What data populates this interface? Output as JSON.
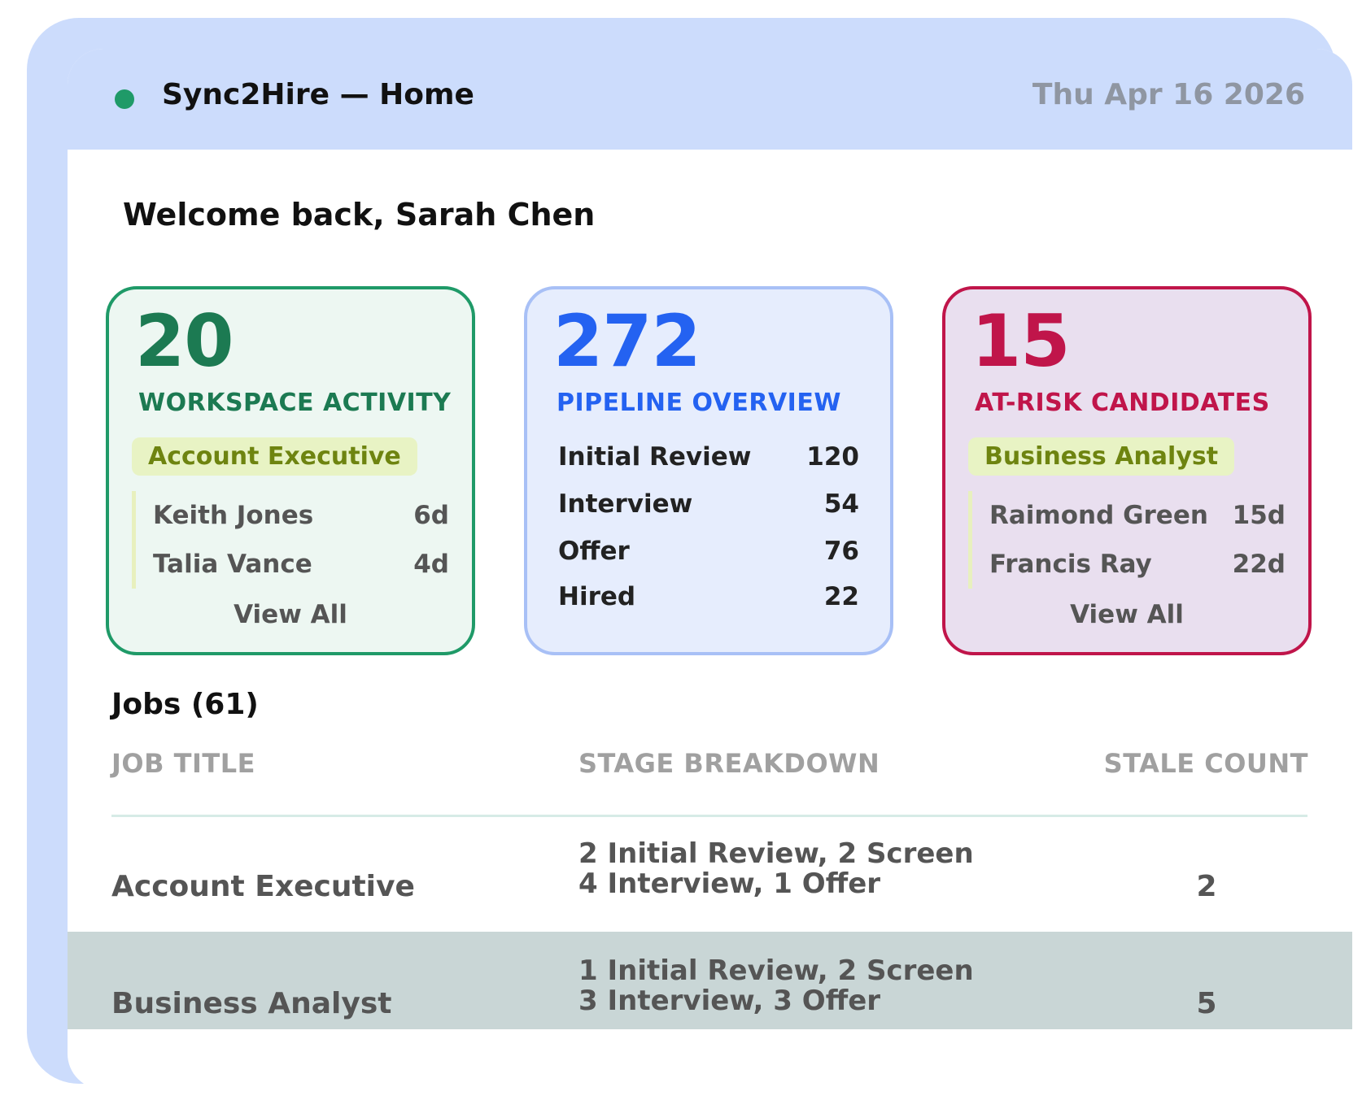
{
  "header": {
    "title": "Sync2Hire — Home",
    "date": "Thu Apr 16 2026",
    "status_color": "#1f9a68"
  },
  "welcome": "Welcome back, Sarah Chen",
  "cards": {
    "workspace": {
      "value": "20",
      "label": "WORKSPACE ACTIVITY",
      "tag": "Account Executive",
      "people": [
        {
          "name": "Keith Jones",
          "days": "6d"
        },
        {
          "name": "Talia Vance",
          "days": "4d"
        }
      ],
      "view_all": "View All",
      "color": "#1c7a52"
    },
    "pipeline": {
      "value": "272",
      "label": "PIPELINE OVERVIEW",
      "stages": [
        {
          "name": "Initial Review",
          "count": "120"
        },
        {
          "name": "Interview",
          "count": "54"
        },
        {
          "name": "Offer",
          "count": "76"
        },
        {
          "name": "Hired",
          "count": "22"
        }
      ],
      "color": "#2462f1"
    },
    "at_risk": {
      "value": "15",
      "label": "AT-RISK CANDIDATES",
      "tag": "Business Analyst",
      "people": [
        {
          "name": "Raimond Green",
          "days": "15d"
        },
        {
          "name": "Francis Ray",
          "days": "22d"
        }
      ],
      "view_all": "View All",
      "color": "#c0154a"
    }
  },
  "jobs": {
    "title": "Jobs (61)",
    "columns": [
      "JOB TITLE",
      "STAGE BREAKDOWN",
      "STALE COUNT"
    ],
    "rows": [
      {
        "title": "Account Executive",
        "stage_line1": "2 Initial Review, 2 Screen",
        "stage_line2": "4 Interview, 1 Offer",
        "stale": "2"
      },
      {
        "title": "Business Analyst",
        "stage_line1": "1 Initial Review, 2 Screen",
        "stage_line2": "3 Interview, 3 Offer",
        "stale": "5"
      }
    ]
  }
}
